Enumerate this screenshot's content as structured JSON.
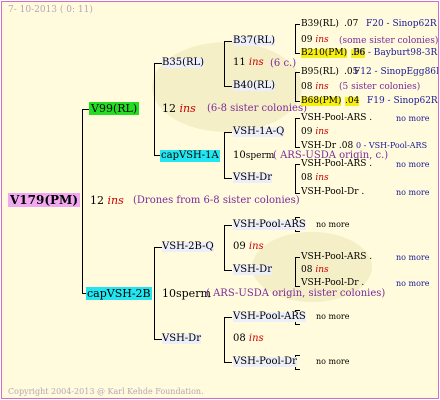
{
  "header": {
    "date": "7- 10-2013 (  0: 11)"
  },
  "footer": {
    "copyright": "Copyright 2004-2013 @ Karl Kehde Foundation."
  },
  "root": {
    "name": "V179(PM)",
    "gen_num": "12",
    "gen_ins": "ins",
    "note": "(Drones from 6-8 sister colonies)"
  },
  "mother": {
    "name": "V99(RL)",
    "gen_num": "12",
    "gen_ins": "ins",
    "note": "(6-8 sister colonies)"
  },
  "b35": {
    "name": "B35(RL)",
    "gen_num": "11",
    "gen_ins": "ins",
    "note": "(6 c.)"
  },
  "b37": {
    "name": "B37(RL)",
    "gen_num": "09",
    "gen_ins": "ins",
    "note": "(some sister colonies)"
  },
  "b39": {
    "name": "B39(RL)",
    "num": ".07",
    "pedigree": "F20 - Sinop62R"
  },
  "b210": {
    "name": "B210(PM)",
    "num": ".06",
    "pedigree": "F6 - Bayburt98-3R"
  },
  "b40": {
    "name": "B40(RL)",
    "gen_num": "08",
    "gen_ins": "ins",
    "note": "(5 sister colonies)"
  },
  "b95": {
    "name": "B95(RL)",
    "num": ".05",
    "pedigree": "F12 - SinopEgg86R"
  },
  "b68": {
    "name": "B68(PM)",
    "num": ".04",
    "pedigree": "F19 - Sinop62R"
  },
  "capvsh1a": {
    "name": "capVSH-1A",
    "gen_num": "10",
    "gen_word": "sperm",
    "note": "( ARS-USDA origin, c.)"
  },
  "vsh1aq": {
    "name": "VSH-1A-Q",
    "gen_num": "09",
    "gen_ins": "ins"
  },
  "vshpool_a1": {
    "name": "VSH-Pool-ARS .",
    "more": "no more"
  },
  "vshdr_a1": {
    "name": "VSH-Dr .08",
    "pedigree": "0 - VSH-Pool-ARS"
  },
  "vshdr_a": {
    "name": "VSH-Dr",
    "gen_num": "08",
    "gen_ins": "ins"
  },
  "vshpool_a2": {
    "name": "VSH-Pool-ARS .",
    "more": "no more"
  },
  "vshpooldr_a2": {
    "name": "VSH-Pool-Dr .",
    "more": "no more"
  },
  "father": {
    "name": "capVSH-2B",
    "gen_num": "10",
    "gen_word": "sperm",
    "note": "( ARS-USDA origin, sister colonies)"
  },
  "vsh2bq": {
    "name": "VSH-2B-Q",
    "gen_num": "09",
    "gen_ins": "ins"
  },
  "vshpool_b1": {
    "name": "VSH-Pool-ARS",
    "more": "no more"
  },
  "vshdr_b1": {
    "name": "VSH-Dr",
    "gen_num": "08",
    "gen_ins": "ins"
  },
  "vshpool_b2": {
    "name": "VSH-Pool-ARS .",
    "more": "no more"
  },
  "vshpooldr_b2": {
    "name": "VSH-Pool-Dr .",
    "more": "no more"
  },
  "vshdr_b": {
    "name": "VSH-Dr",
    "gen_num": "08",
    "gen_ins": "ins"
  },
  "vshpool_b3": {
    "name": "VSH-Pool-ARS",
    "more": "no more"
  },
  "vshpooldr_b3": {
    "name": "VSH-Pool-Dr",
    "more": "no more"
  },
  "colors": {
    "border": "#d36bd3",
    "background": "#fffbdc",
    "green": "#22dd22",
    "cyan": "#22e5f0",
    "yellow": "#f7ee12",
    "pink": "#f0a8f0",
    "ins_red": "#cc0000",
    "note_purple": "#7a2a9a",
    "pedigree_blue": "#1a1a9a"
  }
}
